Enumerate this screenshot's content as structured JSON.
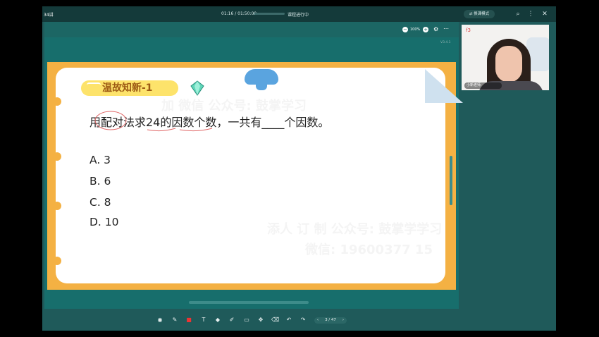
{
  "header": {
    "course": "34讲",
    "time": "01:16 / 01:50:00",
    "progress_fraction": 0.02,
    "status": "课程进行中",
    "switch_mode": "换课模式",
    "icons": [
      "zoom-icon",
      "more-icon",
      "close-icon"
    ]
  },
  "board": {
    "zoom": "100%",
    "version": "V3.4.1"
  },
  "slide": {
    "title": "温故知新-1",
    "question": "用配对法求24的因数个数，一共有____个因数。",
    "options": [
      "A.  3",
      "B.  6",
      "C.  8",
      "D.  10"
    ],
    "watermarks": [
      "加 微信 公众号: 鼓掌学习",
      "添人 订 制 公众号: 鼓掌学学习",
      "微信: 19600377 15"
    ],
    "colors": {
      "frame": "#f4b143",
      "title_pill": "#fde36b",
      "title_text": "#9d5a14",
      "ink": "#e06868"
    }
  },
  "toolbar": {
    "tools": [
      "record-icon",
      "pen-icon",
      "color-swatch",
      "text-icon",
      "tag-icon",
      "eraser-icon",
      "screen-icon",
      "move-icon",
      "trash-icon",
      "undo-icon",
      "redo-icon"
    ],
    "page": "3 / 47"
  },
  "video": {
    "logo": "f3",
    "name": "小新老师"
  }
}
